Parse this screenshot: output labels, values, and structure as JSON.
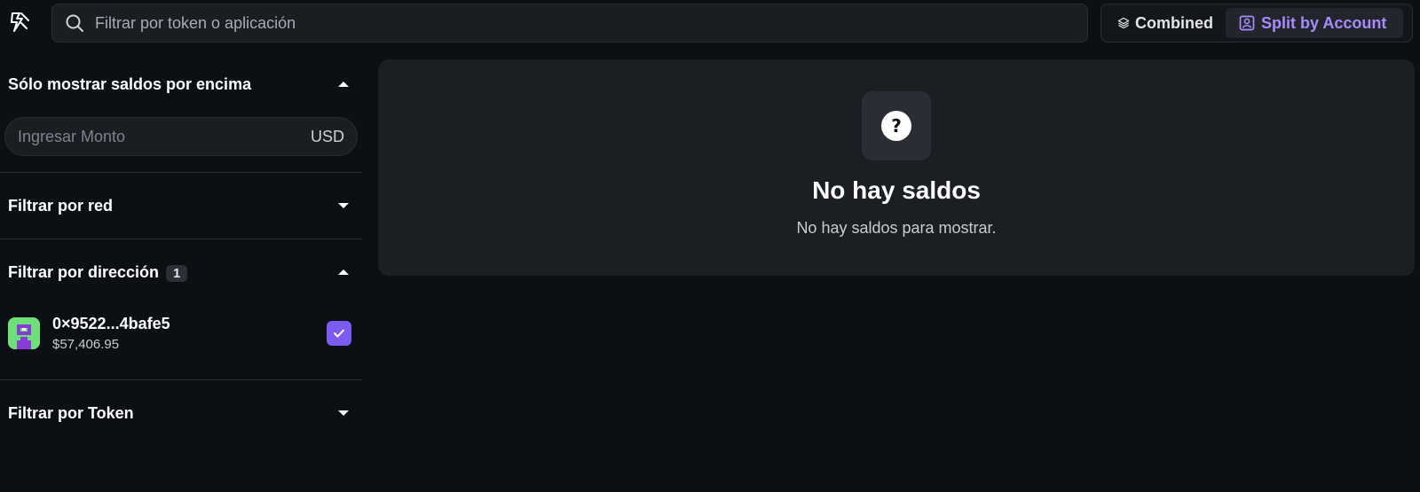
{
  "search": {
    "placeholder": "Filtrar por token o aplicación"
  },
  "view_toggle": {
    "combined_label": "Combined",
    "split_label": "Split by Account",
    "selected": "Split by Account"
  },
  "sidebar": {
    "min_balance": {
      "title": "Sólo mostrar saldos por encima",
      "placeholder": "Ingresar Monto",
      "currency": "USD",
      "expanded": true
    },
    "network": {
      "title": "Filtrar por red",
      "expanded": false
    },
    "address": {
      "title": "Filtrar por dirección",
      "count": "1",
      "expanded": true,
      "accounts": [
        {
          "address": "0×9522...4bafe5",
          "balance": "$57,406.95",
          "checked": true
        }
      ]
    },
    "token": {
      "title": "Filtrar por Token",
      "expanded": false
    }
  },
  "empty_state": {
    "icon": "question-icon",
    "title": "No hay saldos",
    "message": "No hay saldos para mostrar."
  },
  "colors": {
    "background": "#0c0f13",
    "panel": "#1b1e23",
    "accent": "#a78bfa",
    "checkbox": "#7c5cf0"
  }
}
